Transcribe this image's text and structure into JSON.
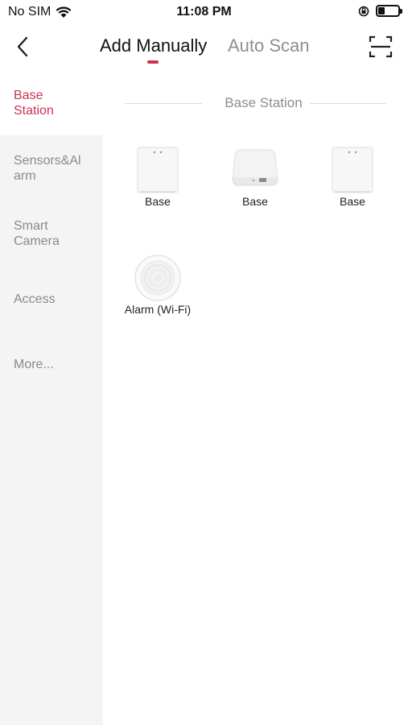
{
  "status": {
    "carrier": "No SIM",
    "time": "11:08 PM",
    "battery_level": 0.35
  },
  "nav": {
    "tab_active": "Add Manually",
    "tab_inactive": "Auto Scan"
  },
  "sidebar": {
    "items": [
      {
        "label": "Base\nStation",
        "active": true
      },
      {
        "label": "Sensors&Al\narm",
        "active": false
      },
      {
        "label": "Smart\nCamera",
        "active": false
      },
      {
        "label": "Access",
        "active": false
      },
      {
        "label": "More...",
        "active": false
      }
    ]
  },
  "section": {
    "title": "Base Station"
  },
  "devices": [
    {
      "label": "Base",
      "icon": "hub-tower-icon"
    },
    {
      "label": "Base",
      "icon": "hub-flat-icon"
    },
    {
      "label": "Base",
      "icon": "hub-tower-icon"
    },
    {
      "label": "Alarm (Wi-Fi)",
      "icon": "smoke-alarm-icon"
    }
  ],
  "colors": {
    "accent": "#c8344f",
    "sidebar_bg": "#f4f4f4",
    "muted_text": "#8e8e8e"
  }
}
